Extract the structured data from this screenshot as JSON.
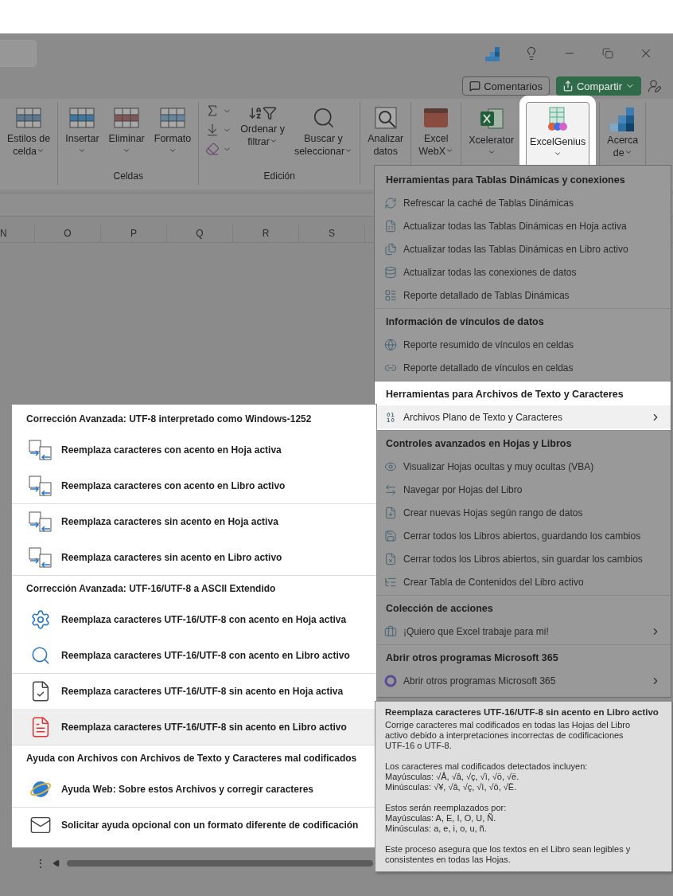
{
  "window": {
    "comments_button": "Comentarios",
    "share_button": "Compartir"
  },
  "ribbon": {
    "groups": [
      {
        "buttons": [
          {
            "kind": "large",
            "lines": [
              "Estilos de",
              "celda"
            ],
            "dropdown": true,
            "highlighted": false
          }
        ]
      },
      {
        "label": "Celdas",
        "buttons": [
          {
            "kind": "large",
            "lines": [
              "Insertar"
            ],
            "dropdown": true,
            "highlighted": false
          },
          {
            "kind": "large",
            "lines": [
              "Eliminar"
            ],
            "dropdown": true,
            "highlighted": false
          },
          {
            "kind": "large",
            "lines": [
              "Formato"
            ],
            "dropdown": true,
            "highlighted": false
          }
        ]
      },
      {
        "label": "Edición",
        "buttons": [
          {
            "kind": "stack",
            "dropdown": true,
            "highlighted": false
          },
          {
            "kind": "large",
            "lines": [
              "Ordenar y",
              "filtrar"
            ],
            "dropdown": true,
            "highlighted": false
          },
          {
            "kind": "large",
            "lines": [
              "Buscar y",
              "seleccionar"
            ],
            "dropdown": true,
            "highlighted": false
          }
        ]
      },
      {
        "buttons": [
          {
            "kind": "large",
            "lines": [
              "Analizar",
              "datos"
            ],
            "dropdown": false,
            "highlighted": false
          }
        ]
      },
      {
        "buttons": [
          {
            "kind": "large",
            "lines": [
              "Excel",
              "WebX"
            ],
            "dropdown": true,
            "highlighted": false
          }
        ]
      },
      {
        "buttons": [
          {
            "kind": "large",
            "lines": [
              "Xcelerator"
            ],
            "dropdown": true,
            "highlighted": false
          },
          {
            "kind": "large",
            "lines": [
              "ExcelGenius"
            ],
            "dropdown": true,
            "highlighted": true
          }
        ]
      },
      {
        "buttons": [
          {
            "kind": "large",
            "lines": [
              "Acerca",
              "de"
            ],
            "dropdown": true,
            "highlighted": false
          }
        ]
      }
    ]
  },
  "columns": [
    "N",
    "O",
    "P",
    "Q",
    "R",
    "S"
  ],
  "main_menu": {
    "sections": [
      {
        "title": "Herramientas para Tablas Dinámicas y conexiones",
        "highlighted": false,
        "items": [
          {
            "label": "Refrescar la caché de Tablas Dinámicas",
            "submenu": false,
            "selected": false
          },
          {
            "label": "Actualizar todas las Tablas Dinámicas en Hoja activa",
            "submenu": false,
            "selected": false
          },
          {
            "label": "Actualizar todas las Tablas Dinámicas en Libro activo",
            "submenu": false,
            "selected": false
          },
          {
            "label": "Actualizar todas las conexiones de datos",
            "submenu": false,
            "selected": false
          },
          {
            "label": "Reporte detallado de Tablas Dinámicas",
            "submenu": false,
            "selected": false
          }
        ]
      },
      {
        "title": "Información de vínculos de datos",
        "highlighted": false,
        "items": [
          {
            "label": "Reporte resumido de vínculos en celdas",
            "submenu": false,
            "selected": false
          },
          {
            "label": "Reporte detallado de vínculos en celdas",
            "submenu": false,
            "selected": false
          }
        ]
      },
      {
        "title": "Herramientas para Archivos de Texto y Caracteres",
        "highlighted": true,
        "items": [
          {
            "label": "Archivos Plano de Texto y Caracteres",
            "submenu": true,
            "selected": true
          }
        ]
      },
      {
        "title": "Controles avanzados en Hojas y Libros",
        "highlighted": false,
        "items": [
          {
            "label": "Visualizar Hojas ocultas y muy ocultas (VBA)",
            "submenu": false,
            "selected": false
          },
          {
            "label": "Navegar por Hojas del Libro",
            "submenu": false,
            "selected": false
          },
          {
            "label": "Crear nuevas Hojas según rango de datos",
            "submenu": false,
            "selected": false
          },
          {
            "label": "Cerrar todos los Libros abiertos, guardando los cambios",
            "submenu": false,
            "selected": false
          },
          {
            "label": "Cerrar todos los Libros abiertos, sin guardar los cambios",
            "submenu": false,
            "selected": false
          },
          {
            "label": "Crear Tabla de Contenidos del Libro activo",
            "submenu": false,
            "selected": false
          }
        ]
      },
      {
        "title": "Colección de acciones",
        "highlighted": false,
        "items": [
          {
            "label": "¡Quiero que Excel trabaje para mi!",
            "submenu": true,
            "selected": false
          }
        ]
      },
      {
        "title": "Abrir otros programas Microsoft 365",
        "highlighted": false,
        "items": [
          {
            "label": "Abrir otros programas Microsoft 365",
            "submenu": true,
            "selected": false
          }
        ]
      }
    ]
  },
  "submenu": {
    "sections": [
      {
        "title": "Corrección Avanzada: UTF-8 interpretado como Windows-1252",
        "items": [
          {
            "label": "Reemplaza caracteres con acento en Hoja activa",
            "separator_before": false,
            "selected": false
          },
          {
            "label": "Reemplaza caracteres con acento en Libro activo",
            "separator_before": false,
            "selected": false
          },
          {
            "label": "Reemplaza caracteres sin acento en Hoja activa",
            "separator_before": true,
            "selected": false
          },
          {
            "label": "Reemplaza caracteres sin acento en Libro activo",
            "separator_before": false,
            "selected": false
          }
        ]
      },
      {
        "title": "Corrección Avanzada: UTF-16/UTF-8 a ASCII Extendido",
        "items": [
          {
            "label": "Reemplaza caracteres UTF-16/UTF-8 con acento en Hoja activa",
            "separator_before": false,
            "selected": false
          },
          {
            "label": "Reemplaza caracteres UTF-16/UTF-8 con acento en Libro activo",
            "separator_before": false,
            "selected": false
          },
          {
            "label": "Reemplaza caracteres UTF-16/UTF-8 sin acento en Hoja activa",
            "separator_before": true,
            "selected": false
          },
          {
            "label": "Reemplaza caracteres UTF-16/UTF-8 sin acento en Libro activo",
            "separator_before": false,
            "selected": true
          }
        ]
      },
      {
        "title": "Ayuda con Archivos con Archivos de Texto y Caracteres mal codificados",
        "items": [
          {
            "label": "Ayuda Web: Sobre estos Archivos y corregir caracteres",
            "separator_before": false,
            "selected": false
          },
          {
            "label": "Solicitar ayuda opcional con un formato diferente de codificación",
            "separator_before": true,
            "selected": false
          }
        ]
      }
    ]
  },
  "tooltip": {
    "title": "Reemplaza caracteres UTF-16/UTF-8 sin acento en Libro activo",
    "paragraphs": [
      [
        "Corrige caracteres mal codificados en todas las Hojas del Libro",
        "activo debido a interpretaciones incorrectas de codificaciones",
        "UTF-16 o UTF-8."
      ],
      [
        "Los caracteres mal codificados detectados incluyen:",
        "Mayúsculas: √Å, √â, √ç, √ì, √ö, √ë.",
        "Minúsculas: √¥, √â, √ç, √ì, √ö, √Ë."
      ],
      [
        "Estos serán reemplazados por:",
        "Mayúsculas: A, E, I, O, U, Ñ.",
        "Minúsculas: a, e, i, o, u, ñ."
      ],
      [
        "Este proceso asegura que los textos en el Libro sean legibles y",
        "consistentes en todas las Hojas."
      ]
    ]
  },
  "scroll_menu": "⋮"
}
